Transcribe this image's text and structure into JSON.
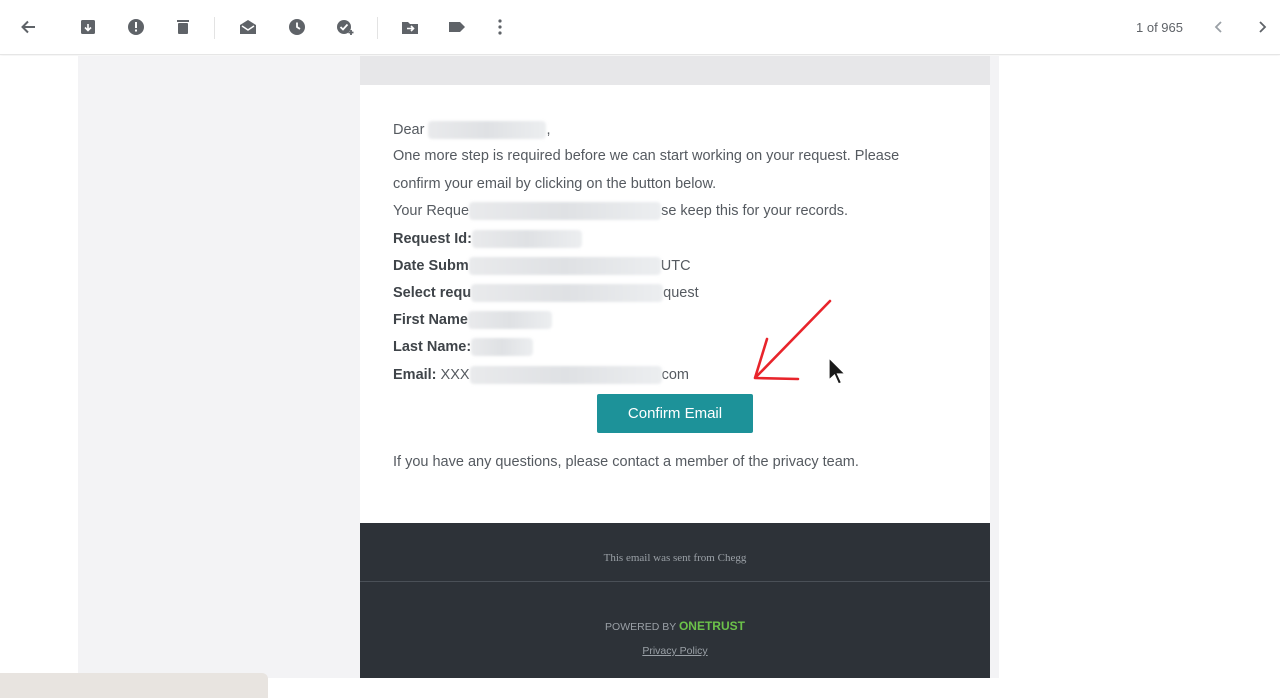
{
  "toolbar": {
    "icons": [
      "back-icon",
      "archive-icon",
      "report-spam-icon",
      "delete-icon",
      "mark-unread-icon",
      "snooze-icon",
      "add-task-icon",
      "move-to-icon",
      "label-icon",
      "more-icon"
    ],
    "pager": "1 of 965"
  },
  "email": {
    "greeting": "Dear",
    "greeting_end": ",",
    "para1": "One more step is required before we can start working on your request. Please",
    "para2": "confirm your email by clicking on the button below.",
    "request_prefix": "Your Reque",
    "request_suffix": "se keep this for your records.",
    "request_id_label": "Request Id:",
    "date_label": "Date Subm",
    "date_suffix": "UTC",
    "select_label": "Select requ",
    "select_suffix": "quest",
    "first_name_label": "First Name",
    "last_name_label": "Last Name:",
    "email_label": "Email:",
    "email_prefix": "XXX",
    "email_suffix": "com",
    "confirm_button": "Confirm Email",
    "questions": "If you have any questions, please contact a member of the privacy team."
  },
  "footer": {
    "sent_from": "This email was sent from Chegg",
    "powered_by": "POWERED BY",
    "brand": "ONETRUST",
    "privacy_policy": "Privacy Policy"
  },
  "colors": {
    "confirm_button": "#1d9299",
    "footer_bg": "#2d3238",
    "brand_green": "#6cc24a",
    "annotation_arrow": "#e8242b"
  }
}
